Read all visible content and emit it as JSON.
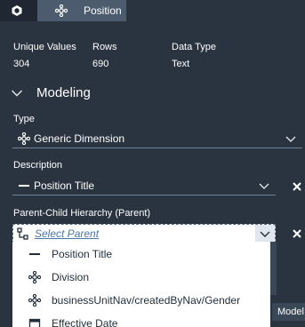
{
  "tabs": {
    "active_label": "Position"
  },
  "stats": {
    "unique_values_label": "Unique Values",
    "unique_values": "304",
    "rows_label": "Rows",
    "rows": "690",
    "data_type_label": "Data Type",
    "data_type": "Text"
  },
  "modeling": {
    "title": "Modeling"
  },
  "type": {
    "label": "Type",
    "value": "Generic Dimension"
  },
  "description": {
    "label": "Description",
    "value": "Position Title"
  },
  "hierarchy": {
    "label": "Parent-Child Hierarchy (Parent)",
    "placeholder": "Select Parent"
  },
  "dropdown": {
    "options": [
      {
        "label": "Position Title",
        "icon": "text-dimension-icon"
      },
      {
        "label": "Division",
        "icon": "dimension-icon"
      },
      {
        "label": "businessUnitNav/createdByNav/Gender",
        "icon": "dimension-icon"
      },
      {
        "label": "Effective Date",
        "icon": "calendar-icon"
      }
    ]
  },
  "side_tab": {
    "label": "Model"
  },
  "colors": {
    "accent": "#5aa0e0",
    "panel": "#2a3440",
    "active_tab": "#4c5c6e"
  }
}
